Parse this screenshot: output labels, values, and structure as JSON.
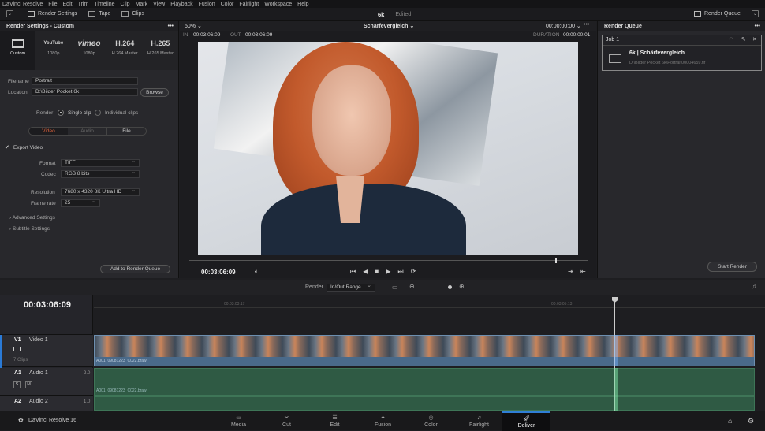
{
  "menu": [
    "DaVinci Resolve",
    "File",
    "Edit",
    "Trim",
    "Timeline",
    "Clip",
    "Mark",
    "View",
    "Playback",
    "Fusion",
    "Color",
    "Fairlight",
    "Workspace",
    "Help"
  ],
  "toolbar": {
    "render_settings": "Render Settings",
    "tape": "Tape",
    "clips": "Clips",
    "project_name": "6k",
    "project_status": "Edited",
    "render_queue": "Render Queue"
  },
  "left": {
    "title": "Render Settings - Custom",
    "presets": [
      {
        "logo": "",
        "label": "Custom"
      },
      {
        "logo": "YouTube",
        "label": "1080p"
      },
      {
        "logo": "vimeo",
        "label": "1080p"
      },
      {
        "logo": "H.264",
        "label": "H.264 Master"
      },
      {
        "logo": "H.265",
        "label": "H.265 Master"
      }
    ],
    "filename_label": "Filename",
    "filename": "Portrait",
    "location_label": "Location",
    "location": "D:\\Bilder Pocket 6k",
    "browse": "Browse",
    "render_label": "Render",
    "single_clip": "Single clip",
    "individual_clips": "Individual clips",
    "tabs": [
      "Video",
      "Audio",
      "File"
    ],
    "export_video": "Export Video",
    "format_label": "Format",
    "format": "TIFF",
    "codec_label": "Codec",
    "codec": "RGB 8 bits",
    "resolution_label": "Resolution",
    "resolution": "7680 x 4320 8K Ultra HD",
    "framerate_label": "Frame rate",
    "framerate": "25",
    "advanced": "Advanced Settings",
    "subtitle": "Subtitle Settings",
    "add_queue": "Add to Render Queue"
  },
  "viewer": {
    "zoom": "50%",
    "in_label": "IN",
    "in_tc": "00:03:06:09",
    "out_label": "OUT",
    "out_tc": "00:03:06:09",
    "title": "Schärfevergleich",
    "tc_top": "00:00:00:00",
    "duration_label": "DURATION",
    "duration": "00:00:00:01",
    "current_tc": "00:03:06:09"
  },
  "queue": {
    "title": "Render Queue",
    "job": "Job 1",
    "job_name": "6k | Schärfevergleich",
    "job_path": "D:\\Bilder Pocket 6k\\Portrait00004659.tif",
    "start": "Start Render"
  },
  "timeline": {
    "render_label": "Render",
    "range": "In/Out Range",
    "tc": "00:03:06:09",
    "ruler1": "00:03:03:17",
    "ruler2": "00:03:05:13",
    "v1": "V1",
    "v1_name": "Video 1",
    "v1_clips": "7 Clips",
    "clip_name": "A001_09081223_C022.braw",
    "a1": "A1",
    "a1_name": "Audio 1",
    "a1_level": "2.0",
    "a2": "A2",
    "a2_name": "Audio 2",
    "a2_level": "1.0",
    "s": "S",
    "m": "M"
  },
  "pages": {
    "brand": "DaVinci Resolve 16",
    "items": [
      "Media",
      "Cut",
      "Edit",
      "Fusion",
      "Color",
      "Fairlight",
      "Deliver"
    ]
  }
}
